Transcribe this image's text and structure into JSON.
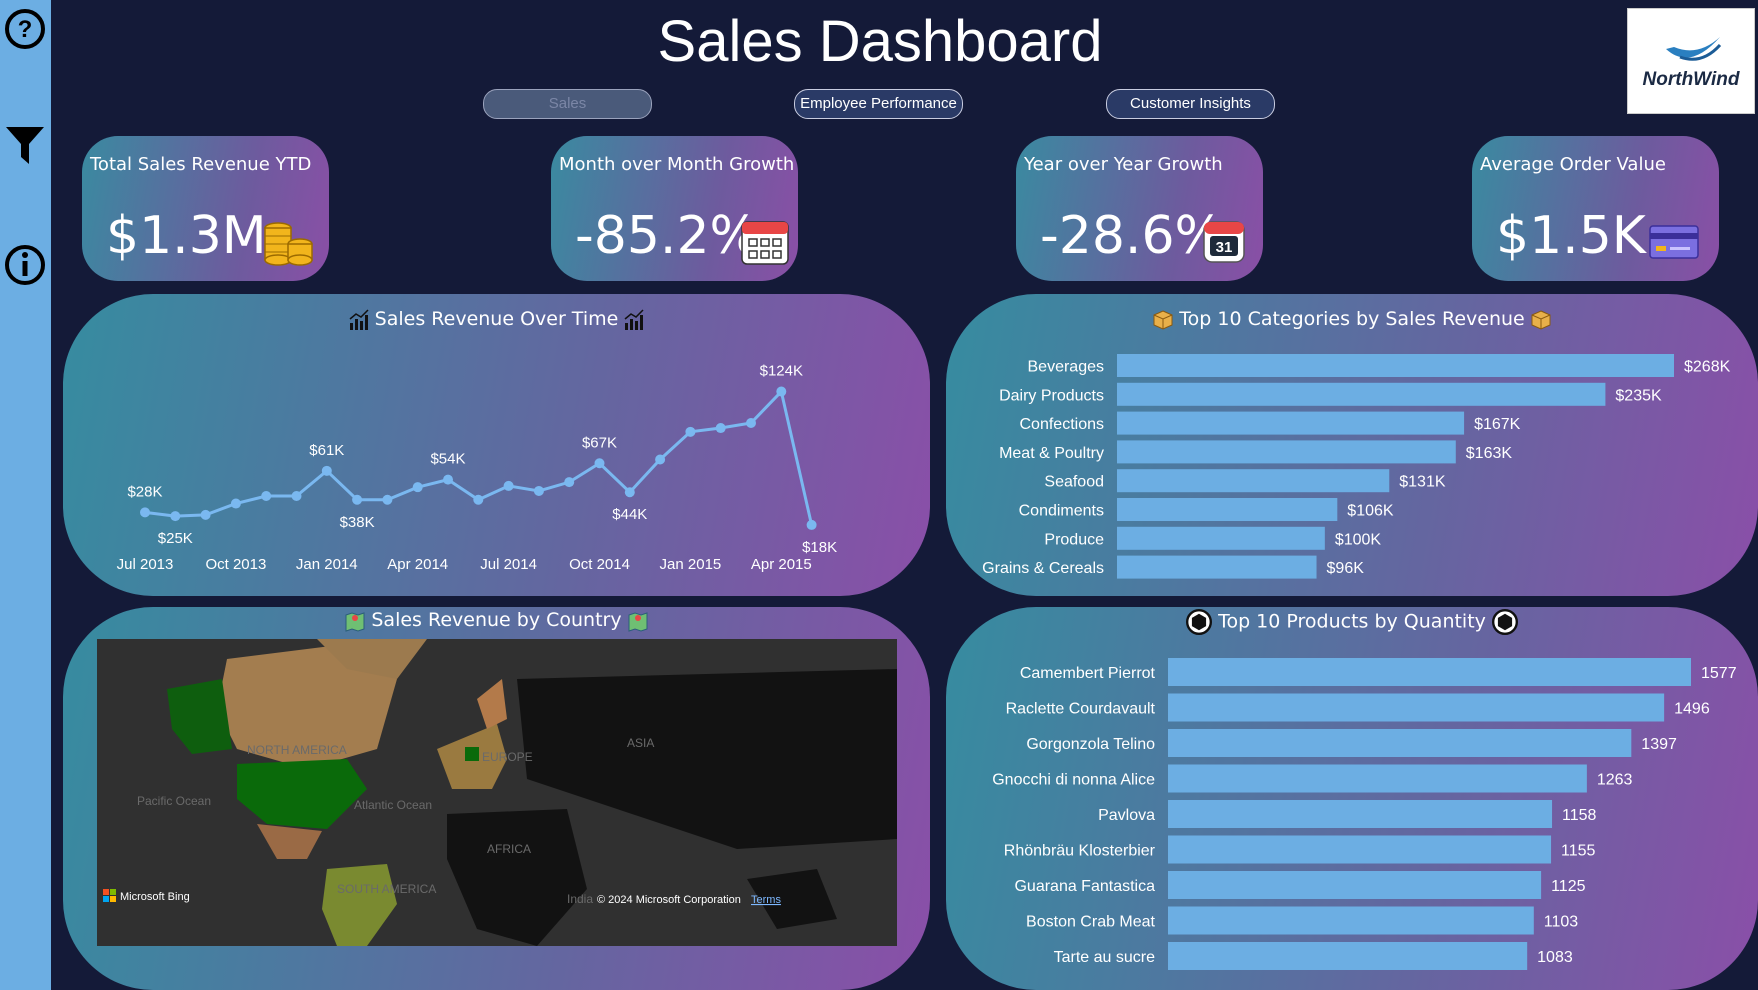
{
  "header": {
    "title": "Sales Dashboard"
  },
  "logo": {
    "text": "NorthWind"
  },
  "sidebar": {
    "icons": [
      "help-icon",
      "filter-icon",
      "info-icon"
    ]
  },
  "nav": [
    {
      "label": "Sales",
      "active": true
    },
    {
      "label": "Employee Performance",
      "active": false
    },
    {
      "label": "Customer Insights",
      "active": false
    }
  ],
  "kpis": [
    {
      "label": "Total Sales Revenue YTD",
      "value": "$1.3M",
      "icon": "coins-icon"
    },
    {
      "label": "Month over Month Growth",
      "value": "-85.2%",
      "icon": "calendar-icon"
    },
    {
      "label": "Year over Year Growth",
      "value": "-28.6%",
      "icon": "calendar-day-icon",
      "icon_badge": "31"
    },
    {
      "label": "Average Order Value",
      "value": "$1.5K",
      "icon": "credit-card-icon"
    }
  ],
  "map": {
    "title": "Sales Revenue by Country",
    "labels": [
      "NORTH AMERICA",
      "EUROPE",
      "ASIA",
      "Pacific Ocean",
      "Atlantic Ocean",
      "AFRICA",
      "SOUTH AMERICA",
      "India"
    ],
    "attribution": "Microsoft Bing",
    "copyright": "© 2024 Microsoft Corporation",
    "terms": "Terms"
  },
  "chart_data": [
    {
      "type": "line",
      "title": "Sales Revenue Over Time",
      "x_ticks": [
        "Jul 2013",
        "Oct 2013",
        "Jan 2014",
        "Apr 2014",
        "Jul 2014",
        "Oct 2014",
        "Jan 2015",
        "Apr 2015"
      ],
      "x": [
        "Jul 2013",
        "Aug 2013",
        "Sep 2013",
        "Oct 2013",
        "Nov 2013",
        "Dec 2013",
        "Jan 2014",
        "Feb 2014",
        "Mar 2014",
        "Apr 2014",
        "May 2014",
        "Jun 2014",
        "Jul 2014",
        "Aug 2014",
        "Sep 2014",
        "Oct 2014",
        "Nov 2014",
        "Dec 2014",
        "Jan 2015",
        "Feb 2015",
        "Mar 2015",
        "Apr 2015",
        "May 2015"
      ],
      "values": [
        28,
        25,
        26,
        35,
        41,
        41,
        61,
        38,
        38,
        48,
        54,
        38,
        49,
        45,
        52,
        67,
        44,
        70,
        92,
        95,
        99,
        124,
        18
      ],
      "unit": "K",
      "data_labels": [
        {
          "i": 0,
          "text": "$28K",
          "pos": "above"
        },
        {
          "i": 1,
          "text": "$25K",
          "pos": "below"
        },
        {
          "i": 6,
          "text": "$61K",
          "pos": "above"
        },
        {
          "i": 7,
          "text": "$38K",
          "pos": "below"
        },
        {
          "i": 10,
          "text": "$54K",
          "pos": "above"
        },
        {
          "i": 15,
          "text": "$67K",
          "pos": "above"
        },
        {
          "i": 16,
          "text": "$44K",
          "pos": "below"
        },
        {
          "i": 21,
          "text": "$124K",
          "pos": "above"
        },
        {
          "i": 22,
          "text": "$18K",
          "pos": "below"
        }
      ],
      "color": "#7ab8f0"
    },
    {
      "type": "bar",
      "orientation": "horizontal",
      "title": "Top 10 Categories by Sales Revenue",
      "categories": [
        "Beverages",
        "Dairy Products",
        "Confections",
        "Meat & Poultry",
        "Seafood",
        "Condiments",
        "Produce",
        "Grains & Cereals"
      ],
      "values": [
        268,
        235,
        167,
        163,
        131,
        106,
        100,
        96
      ],
      "labels": [
        "$268K",
        "$235K",
        "$167K",
        "$163K",
        "$131K",
        "$106K",
        "$100K",
        "$96K"
      ],
      "color": "#6caee3"
    },
    {
      "type": "bar",
      "orientation": "horizontal",
      "title": "Top 10 Products by Quantity",
      "categories": [
        "Camembert Pierrot",
        "Raclette Courdavault",
        "Gorgonzola Telino",
        "Gnocchi di nonna Alice",
        "Pavlova",
        "Rhönbräu Klosterbier",
        "Guarana Fantastica",
        "Boston Crab Meat",
        "Tarte au sucre"
      ],
      "values": [
        1577,
        1496,
        1397,
        1263,
        1158,
        1155,
        1125,
        1103,
        1083
      ],
      "labels": [
        "1577",
        "1496",
        "1397",
        "1263",
        "1158",
        "1155",
        "1125",
        "1103",
        "1083"
      ],
      "color": "#6caee3"
    }
  ]
}
